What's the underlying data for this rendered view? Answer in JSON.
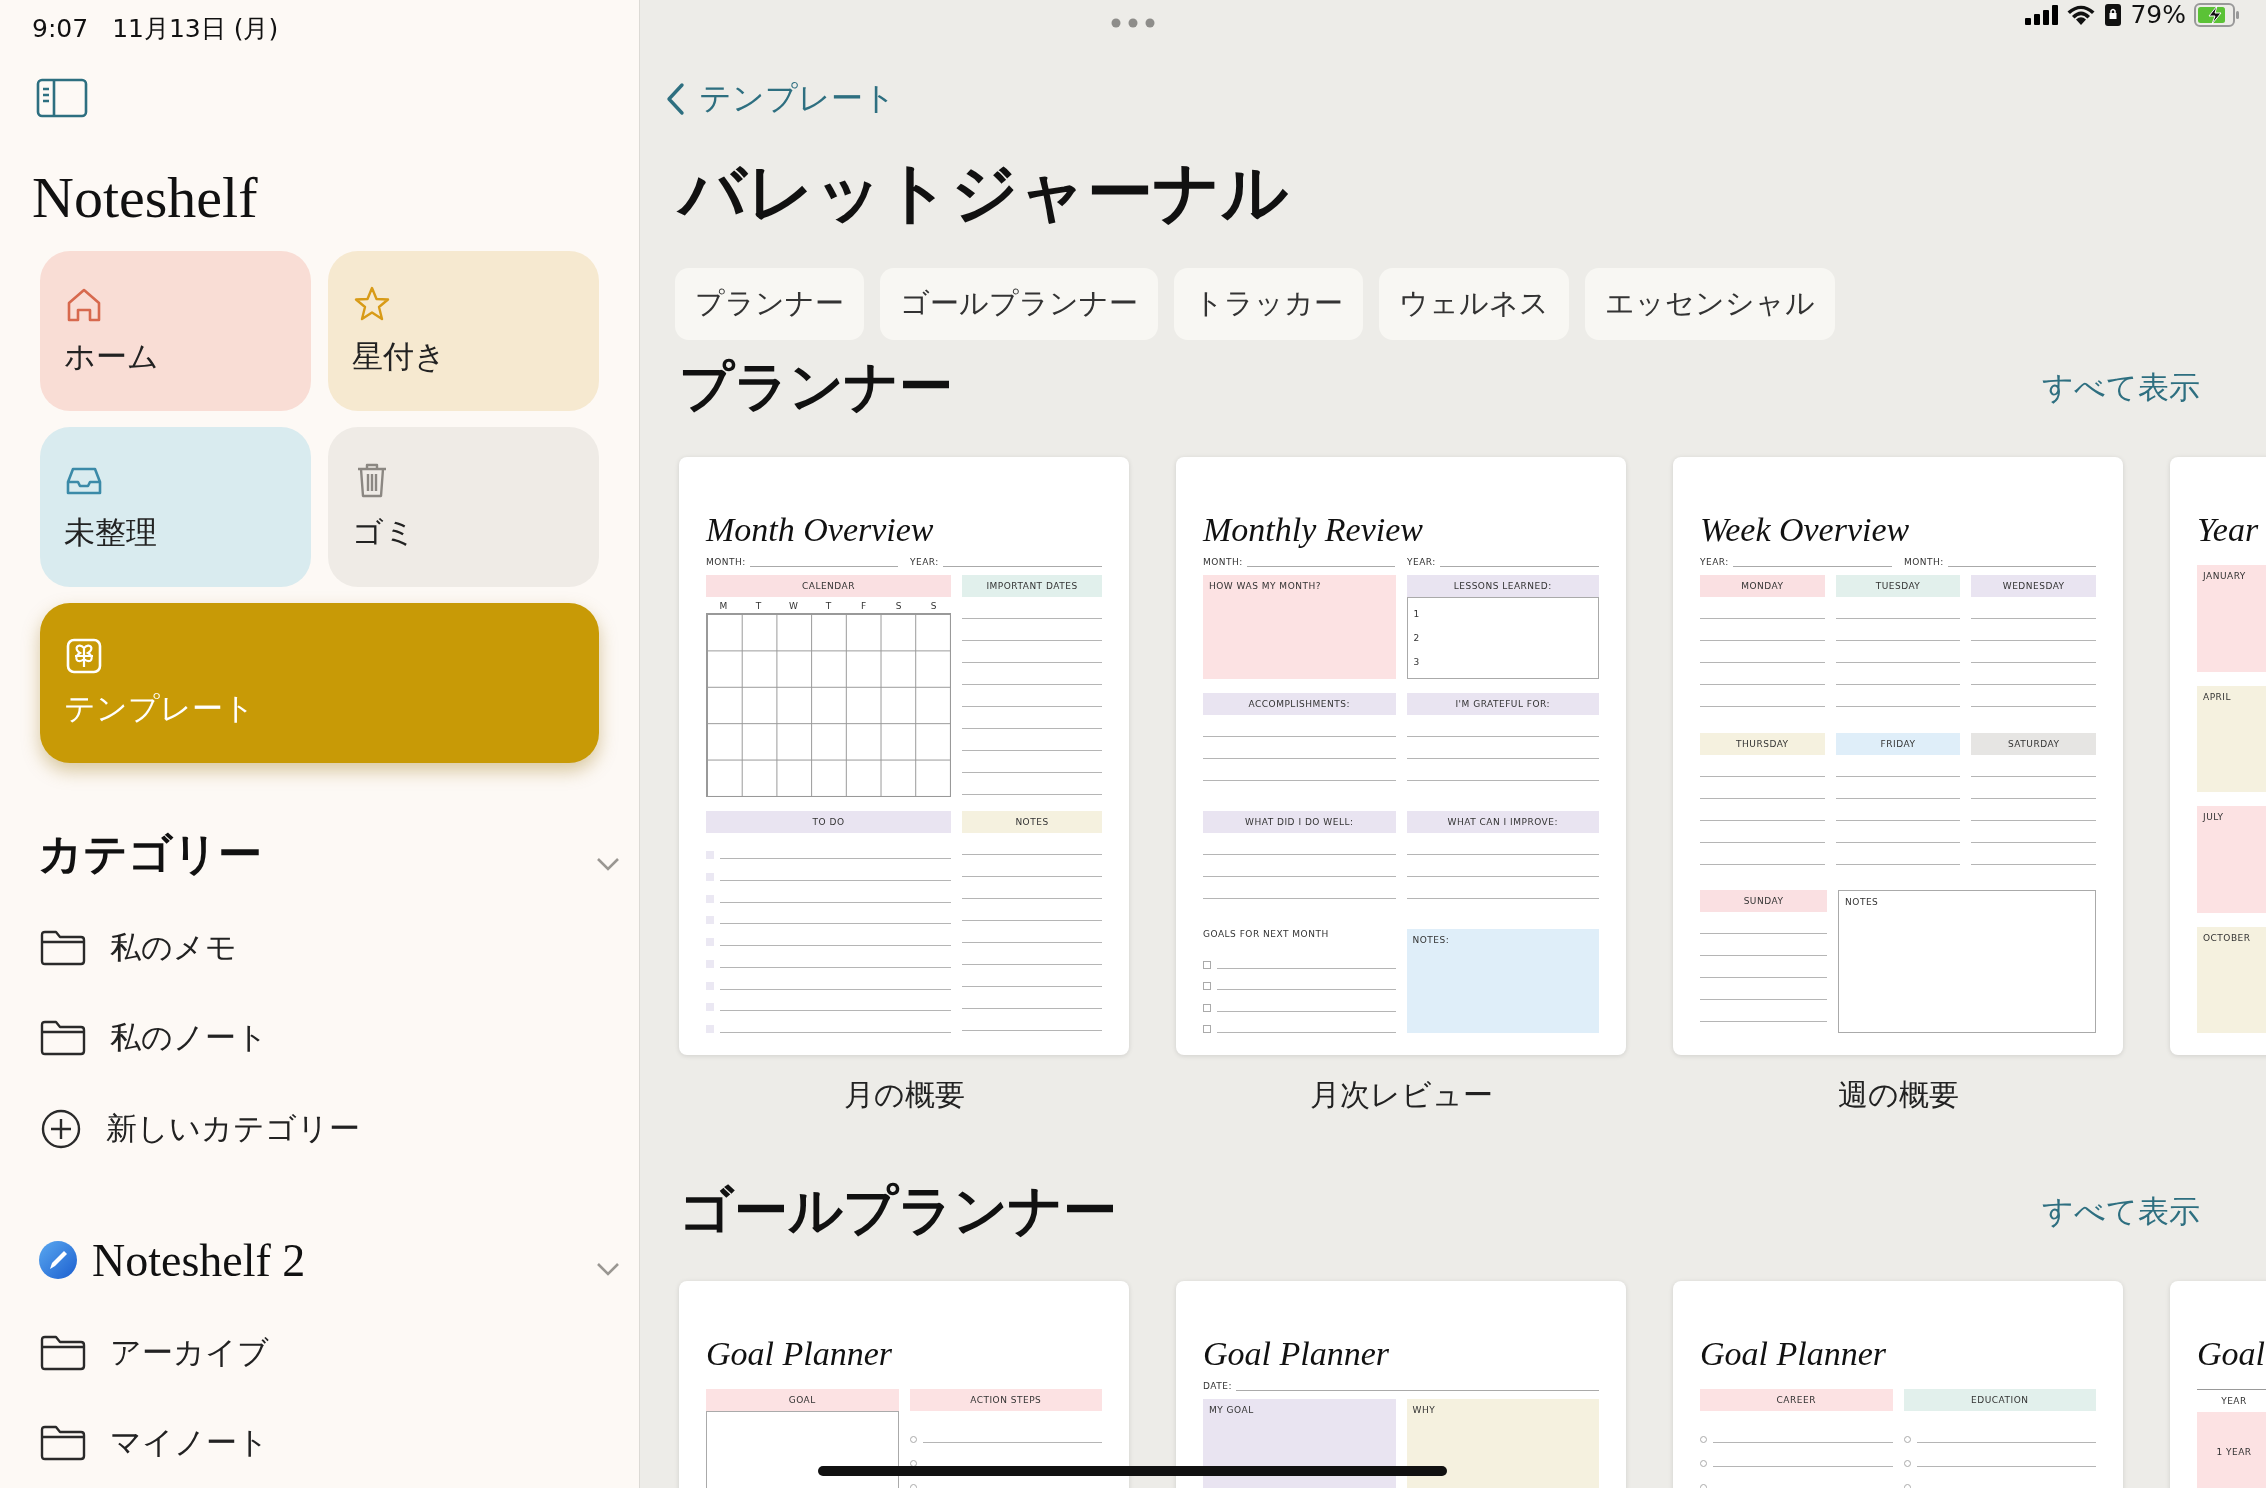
{
  "status_bar": {
    "time": "9:07",
    "date": "11月13日 (月)",
    "battery": "79%"
  },
  "sidebar": {
    "app_title": "Noteshelf",
    "tiles": [
      {
        "kind": "home",
        "label": "ホーム",
        "color": "#f9ddd5",
        "selected": false
      },
      {
        "kind": "starred",
        "label": "星付き",
        "color": "#f6e9d0",
        "selected": false
      },
      {
        "kind": "unfiled",
        "label": "未整理",
        "color": "#d9ebef",
        "selected": false
      },
      {
        "kind": "trash",
        "label": "ゴミ",
        "color": "#efebe6",
        "selected": false
      },
      {
        "kind": "templates",
        "label": "テンプレート",
        "color": "#c89a06",
        "selected": true
      }
    ],
    "groups": [
      {
        "kind": "categories",
        "title": "カテゴリー",
        "expanded": true,
        "items": [
          {
            "kind": "folder",
            "label": "私のメモ"
          },
          {
            "kind": "folder",
            "label": "私のノート"
          },
          {
            "kind": "add",
            "label": "新しいカテゴリー"
          }
        ]
      },
      {
        "kind": "account",
        "title": "Noteshelf 2",
        "expanded": true,
        "items": [
          {
            "kind": "folder",
            "label": "アーカイブ"
          },
          {
            "kind": "folder",
            "label": "マイノート"
          }
        ]
      }
    ]
  },
  "main": {
    "back": "テンプレート",
    "title": "バレットジャーナル",
    "chips": [
      "プランナー",
      "ゴールプランナー",
      "トラッカー",
      "ウェルネス",
      "エッセンシャル"
    ],
    "sections": [
      {
        "title": "プランナー",
        "see_all": "すべて表示",
        "templates": [
          {
            "name": "月の概要",
            "page": {
              "title": "Month Overview",
              "fields": [
                "MONTH:",
                "YEAR:"
              ],
              "rows": [
                {
                  "cols": [
                    {
                      "kind": "calendar",
                      "label": "CALENDAR",
                      "color": "#fae0e2",
                      "items": [
                        "M",
                        "T",
                        "W",
                        "T",
                        "F",
                        "S",
                        "S"
                      ]
                    },
                    {
                      "kind": "lines",
                      "label": "IMPORTANT DATES",
                      "color": "#e1f0ec"
                    }
                  ]
                },
                {
                  "cols": [
                    {
                      "kind": "todo",
                      "label": "TO DO",
                      "color": "#e9e4f1"
                    },
                    {
                      "kind": "lines",
                      "label": "NOTES",
                      "color": "#f5f1df"
                    }
                  ]
                }
              ]
            }
          },
          {
            "name": "月次レビュー",
            "page": {
              "title": "Monthly Review",
              "fields": [
                "MONTH:",
                "YEAR:"
              ],
              "rows": [
                {
                  "cols": [
                    {
                      "kind": "box",
                      "label": "HOW WAS MY MONTH?",
                      "color": "#fce2e3"
                    },
                    {
                      "kind": "numbered",
                      "label": "LESSONS LEARNED:",
                      "color": "#e9e4f1",
                      "items": [
                        "1",
                        "2",
                        "3"
                      ]
                    }
                  ]
                },
                {
                  "cols": [
                    {
                      "kind": "lines",
                      "label": "ACCOMPLISHMENTS:",
                      "color": "#e9e4f1"
                    },
                    {
                      "kind": "lines",
                      "label": "I'M GRATEFUL FOR:",
                      "color": "#e9e4f1"
                    }
                  ]
                },
                {
                  "cols": [
                    {
                      "kind": "lines",
                      "label": "WHAT DID I DO WELL:",
                      "color": "#e9e4f1"
                    },
                    {
                      "kind": "lines",
                      "label": "WHAT CAN I IMPROVE:",
                      "color": "#e9e4f1"
                    }
                  ]
                },
                {
                  "cols": [
                    {
                      "kind": "checklist",
                      "label": "GOALS FOR NEXT MONTH"
                    },
                    {
                      "kind": "box",
                      "label": "NOTES:",
                      "color": "#dfeef9"
                    }
                  ]
                }
              ]
            }
          },
          {
            "name": "週の概要",
            "page": {
              "title": "Week Overview",
              "fields": [
                "YEAR:",
                "MONTH:"
              ],
              "rows": [
                {
                  "cols": [
                    {
                      "kind": "lines",
                      "label": "MONDAY",
                      "color": "#fae0e2"
                    },
                    {
                      "kind": "lines",
                      "label": "TUESDAY",
                      "color": "#e2f0ec"
                    },
                    {
                      "kind": "lines",
                      "label": "WEDNESDAY",
                      "color": "#e9e4f1"
                    }
                  ]
                },
                {
                  "cols": [
                    {
                      "kind": "lines",
                      "label": "THURSDAY",
                      "color": "#f5f1df"
                    },
                    {
                      "kind": "lines",
                      "label": "FRIDAY",
                      "color": "#dfeef9"
                    },
                    {
                      "kind": "lines",
                      "label": "SATURDAY",
                      "color": "#e6e5e3"
                    }
                  ]
                },
                {
                  "cols": [
                    {
                      "kind": "lines",
                      "label": "SUNDAY",
                      "color": "#fae0e2"
                    },
                    {
                      "kind": "framed",
                      "label": "NOTES"
                    }
                  ]
                }
              ]
            }
          },
          {
            "page": {
              "title": "Year",
              "rows": [
                {
                  "cols": [
                    {
                      "kind": "box",
                      "label": "JANUARY",
                      "color": "#fce2e3"
                    }
                  ]
                },
                {
                  "cols": [
                    {
                      "kind": "box",
                      "label": "APRIL",
                      "color": "#f5f1df"
                    }
                  ]
                },
                {
                  "cols": [
                    {
                      "kind": "box",
                      "label": "JULY",
                      "color": "#fce2e3"
                    }
                  ]
                },
                {
                  "cols": [
                    {
                      "kind": "box",
                      "label": "OCTOBER",
                      "color": "#f5f1df"
                    }
                  ]
                }
              ]
            }
          }
        ]
      },
      {
        "title": "ゴールプランナー",
        "see_all": "すべて表示",
        "templates": [
          {
            "page": {
              "title": "Goal Planner",
              "rows": [
                {
                  "cols": [
                    {
                      "kind": "frame",
                      "label": "GOAL",
                      "color": "#fce2e3"
                    },
                    {
                      "kind": "circles",
                      "label": "ACTION STEPS",
                      "color": "#fce2e3"
                    }
                  ]
                }
              ]
            }
          },
          {
            "page": {
              "title": "Goal Planner",
              "fields": [
                "DATE:"
              ],
              "rows": [
                {
                  "cols": [
                    {
                      "kind": "box",
                      "label": "MY GOAL",
                      "color": "#e9e4f1"
                    },
                    {
                      "kind": "box",
                      "label": "WHY",
                      "color": "#f5f1df"
                    }
                  ]
                }
              ]
            }
          },
          {
            "page": {
              "title": "Goal Planner",
              "rows": [
                {
                  "cols": [
                    {
                      "kind": "circles",
                      "label": "CAREER",
                      "color": "#fce2e3"
                    },
                    {
                      "kind": "circles",
                      "label": "EDUCATION",
                      "color": "#e2f0ec"
                    }
                  ]
                }
              ]
            }
          },
          {
            "page": {
              "title": "Goal",
              "rows": [
                {
                  "cols": [
                    {
                      "kind": "period",
                      "label": "YEAR",
                      "color": "#fce2e3",
                      "items": [
                        "1 YEAR"
                      ]
                    }
                  ]
                }
              ]
            }
          }
        ]
      }
    ]
  }
}
